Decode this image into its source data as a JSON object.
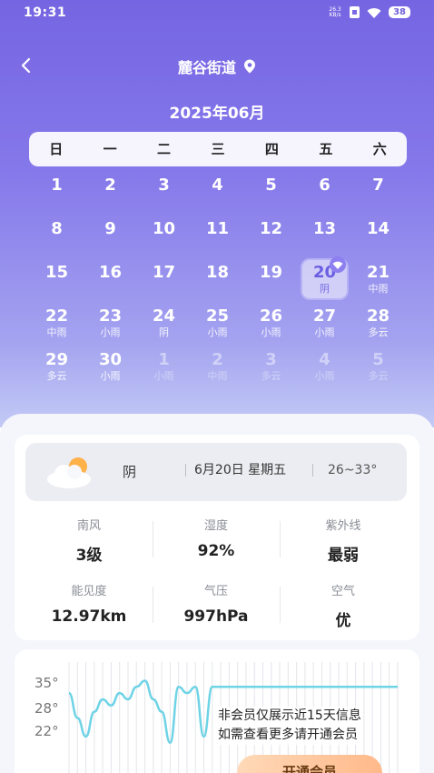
{
  "status_bar": {
    "time": "19:31",
    "net_speed_value": "26.3",
    "net_speed_unit": "KB/s",
    "battery": "38"
  },
  "header": {
    "title": "麓谷街道",
    "month": "2025年06月"
  },
  "calendar": {
    "weekdays": [
      "日",
      "一",
      "二",
      "三",
      "四",
      "五",
      "六"
    ],
    "selected_day": "20",
    "rows": [
      [
        {
          "d": "1",
          "s": ""
        },
        {
          "d": "2",
          "s": ""
        },
        {
          "d": "3",
          "s": ""
        },
        {
          "d": "4",
          "s": ""
        },
        {
          "d": "5",
          "s": ""
        },
        {
          "d": "6",
          "s": ""
        },
        {
          "d": "7",
          "s": ""
        }
      ],
      [
        {
          "d": "8",
          "s": ""
        },
        {
          "d": "9",
          "s": ""
        },
        {
          "d": "10",
          "s": ""
        },
        {
          "d": "11",
          "s": ""
        },
        {
          "d": "12",
          "s": ""
        },
        {
          "d": "13",
          "s": ""
        },
        {
          "d": "14",
          "s": ""
        }
      ],
      [
        {
          "d": "15",
          "s": ""
        },
        {
          "d": "16",
          "s": ""
        },
        {
          "d": "17",
          "s": ""
        },
        {
          "d": "18",
          "s": ""
        },
        {
          "d": "19",
          "s": ""
        },
        {
          "d": "20",
          "s": "阴"
        },
        {
          "d": "21",
          "s": "中雨"
        }
      ],
      [
        {
          "d": "22",
          "s": "中雨"
        },
        {
          "d": "23",
          "s": "小雨"
        },
        {
          "d": "24",
          "s": "阴"
        },
        {
          "d": "25",
          "s": "小雨"
        },
        {
          "d": "26",
          "s": "小雨"
        },
        {
          "d": "27",
          "s": "小雨"
        },
        {
          "d": "28",
          "s": "多云"
        }
      ],
      [
        {
          "d": "29",
          "s": "多云"
        },
        {
          "d": "30",
          "s": "小雨"
        },
        {
          "d": "1",
          "s": "小雨"
        },
        {
          "d": "2",
          "s": "中雨"
        },
        {
          "d": "3",
          "s": "多云"
        },
        {
          "d": "4",
          "s": "小雨"
        },
        {
          "d": "5",
          "s": "多云"
        }
      ]
    ]
  },
  "summary": {
    "condition": "阴",
    "date": "6月20日 星期五",
    "temp_range": "26~33°"
  },
  "stats": [
    [
      {
        "label": "南风",
        "value": "3级"
      },
      {
        "label": "湿度",
        "value": "92%"
      },
      {
        "label": "紫外线",
        "value": "最弱"
      }
    ],
    [
      {
        "label": "能见度",
        "value": "12.97km"
      },
      {
        "label": "气压",
        "value": "997hPa"
      },
      {
        "label": "空气",
        "value": "优"
      }
    ]
  ],
  "trend": {
    "yticks": [
      "35°",
      "28°",
      "22°"
    ],
    "notice_line1": "非会员仅展示近15天信息",
    "notice_line2": "如需查看更多请开通会员",
    "button": "开通会员"
  },
  "chart_data": {
    "type": "line",
    "yticks": [
      "35°",
      "28°",
      "22°"
    ],
    "ylim": [
      20,
      37
    ],
    "series": [
      {
        "values": [
          32,
          28,
          25,
          29,
          31,
          30,
          32,
          31,
          33,
          34,
          31,
          29,
          24,
          33,
          32,
          33,
          25,
          33,
          33,
          33,
          33,
          33,
          33,
          33,
          33,
          33,
          33,
          33,
          33,
          33,
          33,
          33,
          33,
          33,
          33,
          33,
          33,
          33,
          33,
          33
        ]
      }
    ],
    "colors": {
      "line": "#6fd3e6",
      "grid": "#e3e5ea"
    }
  }
}
